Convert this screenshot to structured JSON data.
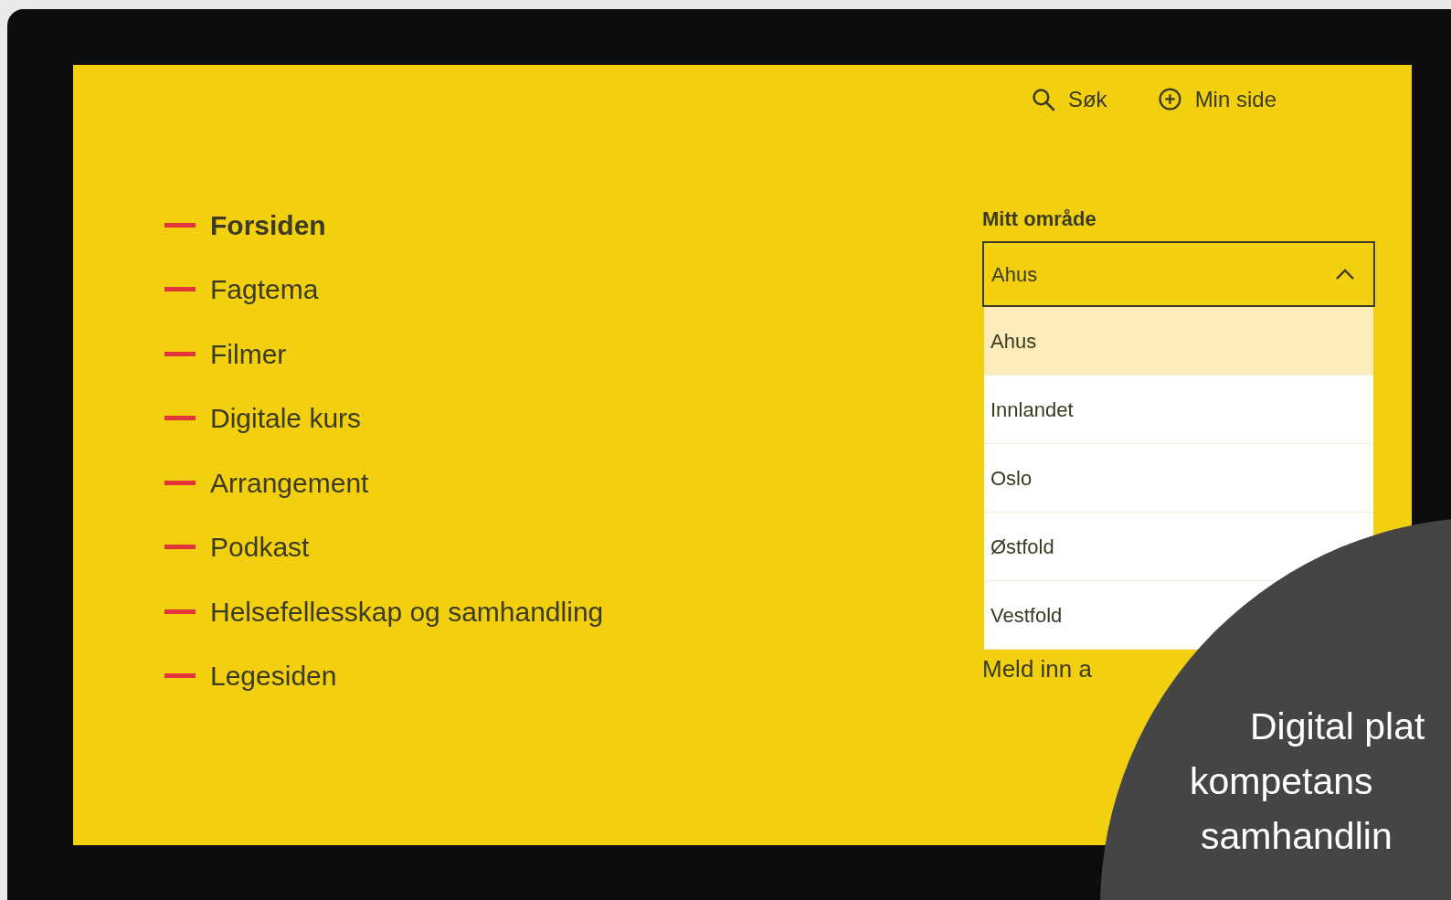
{
  "header_links": [
    {
      "kind": "search",
      "label": "Søk"
    },
    {
      "kind": "add",
      "label": "Min side"
    }
  ],
  "nav": {
    "items": [
      {
        "label": "Forsiden",
        "selected": true
      },
      {
        "label": "Fagtema",
        "selected": false
      },
      {
        "label": "Filmer",
        "selected": false
      },
      {
        "label": "Digitale kurs",
        "selected": false
      },
      {
        "label": "Arrangement",
        "selected": false
      },
      {
        "label": "Podkast",
        "selected": false
      },
      {
        "label": "Helsefellesskap og samhandling",
        "selected": false
      },
      {
        "label": "Legesiden",
        "selected": false
      }
    ]
  },
  "area_select": {
    "label": "Mitt område",
    "value": "Ahus",
    "expanded": true,
    "options": [
      {
        "label": "Ahus",
        "selected": true
      },
      {
        "label": "Innlandet",
        "selected": false
      },
      {
        "label": "Oslo",
        "selected": false
      },
      {
        "label": "Østfold",
        "selected": false
      },
      {
        "label": "Vestfold",
        "selected": false
      }
    ]
  },
  "link_text": "Meld inn a",
  "overlay": {
    "lines": [
      "Digital plat",
      "kompetans",
      "samhandlin"
    ]
  }
}
